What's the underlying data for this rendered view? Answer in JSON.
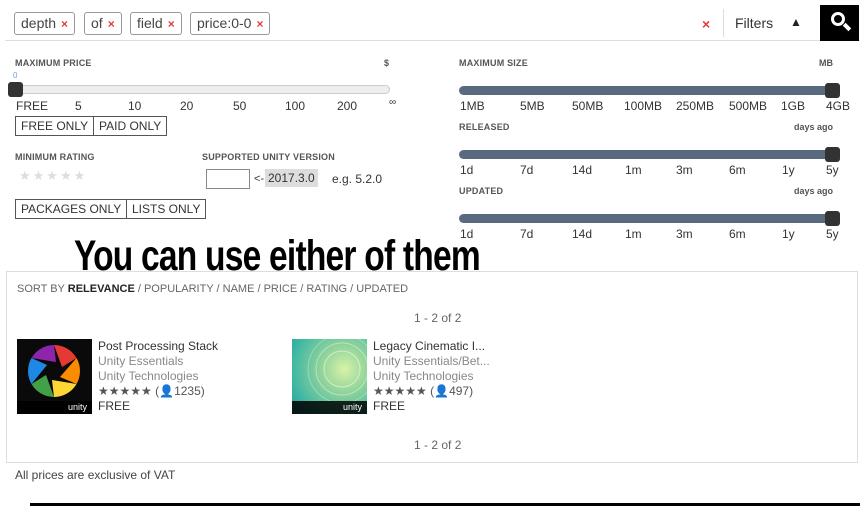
{
  "search": {
    "chips": [
      {
        "label": "depth"
      },
      {
        "label": "of"
      },
      {
        "label": "field"
      },
      {
        "label": "price:0-0"
      }
    ],
    "clear_symbol": "×",
    "chip_remove_symbol": "×",
    "filters_label": "Filters",
    "filters_caret": "▲"
  },
  "price": {
    "label": "MAXIMUM PRICE",
    "unit": "$",
    "current_value_label": "0",
    "value": 0,
    "ticks": [
      "FREE",
      "5",
      "10",
      "20",
      "50",
      "100",
      "200",
      "∞"
    ],
    "buttons": [
      "FREE ONLY",
      "PAID ONLY"
    ]
  },
  "size": {
    "label": "MAXIMUM SIZE",
    "unit": "MB",
    "value_fraction": 1.0,
    "ticks": [
      "1MB",
      "5MB",
      "50MB",
      "100MB",
      "250MB",
      "500MB",
      "1GB",
      "4GB"
    ]
  },
  "released": {
    "label": "RELEASED",
    "unit": "days ago",
    "value_fraction": 1.0,
    "ticks": [
      "1d",
      "7d",
      "14d",
      "1m",
      "3m",
      "6m",
      "1y",
      "5y"
    ]
  },
  "updated": {
    "label": "UPDATED",
    "unit": "days ago",
    "value_fraction": 1.0,
    "ticks": [
      "1d",
      "7d",
      "14d",
      "1m",
      "3m",
      "6m",
      "1y",
      "5y"
    ]
  },
  "rating": {
    "label": "MINIMUM RATING",
    "stars": "★★★★★"
  },
  "unity_version": {
    "label": "SUPPORTED UNITY VERSION",
    "arrow": "<-",
    "current": "2017.3.0",
    "example": "e.g. 5.2.0"
  },
  "type_buttons": [
    "PACKAGES ONLY",
    "LISTS ONLY"
  ],
  "overlay_text": "You can use either of them",
  "sort": {
    "prefix": "SORT BY",
    "active": "RELEVANCE",
    "rest": "/ POPULARITY / NAME / PRICE / RATING / UPDATED"
  },
  "pagination": "1 - 2 of 2",
  "products": [
    {
      "title": "Post Processing Stack",
      "publisher": "Unity Essentials",
      "author": "Unity Technologies",
      "stars": "★★★★★",
      "reviews": "(👤1235)",
      "price": "FREE",
      "badge": "unity"
    },
    {
      "title": "Legacy Cinematic I...",
      "publisher": "Unity Essentials/Bet...",
      "author": "Unity Technologies",
      "stars": "★★★★★",
      "reviews": "(👤497)",
      "price": "FREE",
      "badge": "unity"
    }
  ],
  "vat_note": "All prices are exclusive of VAT"
}
